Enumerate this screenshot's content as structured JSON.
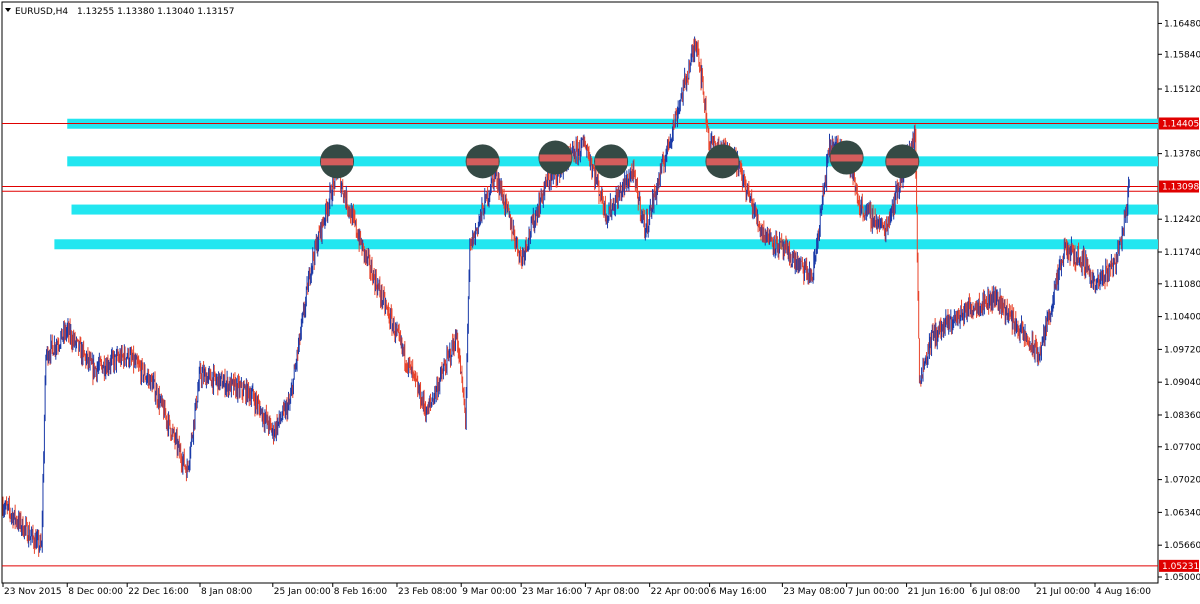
{
  "header": {
    "symbol_timeframe": "EURUSD,H4",
    "ohlc": "1.13255 1.13380 1.13040 1.13157"
  },
  "colors": {
    "background": "#ffffff",
    "bull": "#1a3aa8",
    "bear": "#e8432a",
    "zone": "#22e6f0",
    "hline": "#e00000",
    "price_tag_bg": "#e00000",
    "price_tag_text": "#ffffff",
    "marker": "#354a45",
    "marker_band": "#f06060",
    "axis": "#000000"
  },
  "chart_data": {
    "type": "candlestick",
    "symbol": "EURUSD",
    "timeframe": "H4",
    "ylim": [
      1.05,
      1.168
    ],
    "y_ticks": [
      "1.16480",
      "1.15840",
      "1.15120",
      "1.14405",
      "1.13780",
      "1.13098",
      "1.12420",
      "1.11740",
      "1.11080",
      "1.10400",
      "1.09720",
      "1.09040",
      "1.08360",
      "1.07700",
      "1.07020",
      "1.06340",
      "1.05660",
      "1.05231",
      "1.05000"
    ],
    "x_ticks": [
      "23 Nov 2015",
      "8 Dec 00:00",
      "22 Dec 16:00",
      "8 Jan 08:00",
      "25 Jan 00:00",
      "8 Feb 16:00",
      "23 Feb 08:00",
      "9 Mar 00:00",
      "23 Mar 16:00",
      "7 Apr 08:00",
      "22 Apr 00:00",
      "6 May 16:00",
      "23 May 08:00",
      "7 Jun 00:00",
      "21 Jun 16:00",
      "6 Jul 08:00",
      "21 Jul 00:00",
      "4 Aug 16:00"
    ],
    "price_path": [
      {
        "date": "23 Nov 2015",
        "price": 1.065
      },
      {
        "date": "2 Dec 2015",
        "price": 1.056
      },
      {
        "date": "3 Dec 2015",
        "price": 1.096
      },
      {
        "date": "8 Dec 2015",
        "price": 1.101
      },
      {
        "date": "14 Dec 2015",
        "price": 1.093
      },
      {
        "date": "22 Dec 2015",
        "price": 1.096
      },
      {
        "date": "28 Dec 2015",
        "price": 1.09
      },
      {
        "date": "5 Jan 2016",
        "price": 1.072
      },
      {
        "date": "8 Jan 2016",
        "price": 1.092
      },
      {
        "date": "20 Jan 2016",
        "price": 1.088
      },
      {
        "date": "25 Jan 2016",
        "price": 1.08
      },
      {
        "date": "29 Jan 2016",
        "price": 1.086
      },
      {
        "date": "3 Feb 2016",
        "price": 1.115
      },
      {
        "date": "9 Feb 2016",
        "price": 1.134
      },
      {
        "date": "15 Feb 2016",
        "price": 1.118
      },
      {
        "date": "23 Feb 2016",
        "price": 1.1
      },
      {
        "date": "1 Mar 2016",
        "price": 1.084
      },
      {
        "date": "8 Mar 2016",
        "price": 1.1
      },
      {
        "date": "10 Mar 2016",
        "price": 1.083
      },
      {
        "date": "11 Mar 2016",
        "price": 1.118
      },
      {
        "date": "17 Mar 2016",
        "price": 1.134
      },
      {
        "date": "23 Mar 2016",
        "price": 1.116
      },
      {
        "date": "29 Mar 2016",
        "price": 1.132
      },
      {
        "date": "7 Apr 2016",
        "price": 1.14
      },
      {
        "date": "12 Apr 2016",
        "price": 1.125
      },
      {
        "date": "18 Apr 2016",
        "price": 1.134
      },
      {
        "date": "21 Apr 2016",
        "price": 1.122
      },
      {
        "date": "3 May 2016",
        "price": 1.1615
      },
      {
        "date": "6 May 2016",
        "price": 1.14
      },
      {
        "date": "12 May 2016",
        "price": 1.137
      },
      {
        "date": "18 May 2016",
        "price": 1.122
      },
      {
        "date": "23 May 2016",
        "price": 1.118
      },
      {
        "date": "30 May 2016",
        "price": 1.112
      },
      {
        "date": "3 Jun 2016",
        "price": 1.139
      },
      {
        "date": "7 Jun 2016",
        "price": 1.139
      },
      {
        "date": "10 Jun 2016",
        "price": 1.127
      },
      {
        "date": "16 Jun 2016",
        "price": 1.122
      },
      {
        "date": "23 Jun 2016",
        "price": 1.142
      },
      {
        "date": "24 Jun 2016",
        "price": 1.091
      },
      {
        "date": "27 Jun 2016",
        "price": 1.1
      },
      {
        "date": "6 Jul 2016",
        "price": 1.106
      },
      {
        "date": "12 Jul 2016",
        "price": 1.108
      },
      {
        "date": "20 Jul 2016",
        "price": 1.098
      },
      {
        "date": "22 Jul 2016",
        "price": 1.096
      },
      {
        "date": "28 Jul 2016",
        "price": 1.118
      },
      {
        "date": "2 Aug 2016",
        "price": 1.115
      },
      {
        "date": "4 Aug 2016",
        "price": 1.11
      },
      {
        "date": "9 Aug 2016",
        "price": 1.116
      },
      {
        "date": "11 Aug 2016",
        "price": 1.124
      },
      {
        "date": "12 Aug 2016",
        "price": 1.1316
      }
    ],
    "horizontal_lines": [
      {
        "price": 1.14405,
        "label": "1.14405"
      },
      {
        "price": 1.13098,
        "label": "1.13098"
      },
      {
        "price": 1.05231,
        "label": "1.05231"
      }
    ],
    "zones": [
      {
        "price": 1.144,
        "start": "8 Dec 2015"
      },
      {
        "price": 1.1362,
        "start": "8 Dec 2015"
      },
      {
        "price": 1.1262,
        "start": "9 Dec 2015"
      },
      {
        "price": 1.119,
        "start": "5 Dec 2015"
      }
    ],
    "markers": [
      {
        "date": "9 Feb 2016",
        "price": 1.1362
      },
      {
        "date": "14 Mar 2016",
        "price": 1.1362
      },
      {
        "date": "31 Mar 2016",
        "price": 1.137
      },
      {
        "date": "13 Apr 2016",
        "price": 1.1362
      },
      {
        "date": "9 May 2016",
        "price": 1.1362
      },
      {
        "date": "7 Jun 2016",
        "price": 1.137
      },
      {
        "date": "20 Jun 2016",
        "price": 1.1362
      }
    ]
  }
}
